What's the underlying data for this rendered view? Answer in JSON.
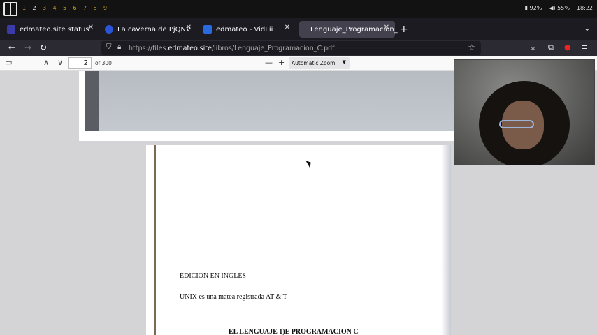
{
  "topbar": {
    "workspaces": [
      "1",
      "2",
      "3",
      "4",
      "5",
      "6",
      "7",
      "8",
      "9"
    ],
    "active_workspace": "2",
    "battery": "92%",
    "volume": "55%",
    "time": "18:22"
  },
  "tabs": [
    {
      "title": "edmateo.site status",
      "favicon": "status-icon",
      "color": "#3a3aa8"
    },
    {
      "title": "La caverna de PjQNV",
      "favicon": "globe-icon",
      "color": "#2a55d8"
    },
    {
      "title": "edmateo - VidLii",
      "favicon": "vidlii-icon",
      "color": "#2a6adf"
    },
    {
      "title": "Lenguaje_Programacion_",
      "favicon": "",
      "color": "#42414d",
      "active": true
    }
  ],
  "navbar": {
    "url_prefix": "https://files.",
    "url_host": "edmateo.site",
    "url_path": "/libros/Lenguaje_Programacion_C.pdf"
  },
  "pdf_toolbar": {
    "page_number": "2",
    "page_count": "of 300",
    "zoom": "Automatic Zoom"
  },
  "document": {
    "line1": "EDICION EN INGLES",
    "line2": "UNIX es una matea registrada AT & T",
    "line3": "EL LENGUAJE 1)E PROGRAMACION C"
  },
  "colors": {
    "tab_active_bg": "#42414d",
    "navbar_bg": "#2b2a33",
    "viewer_bg": "#d4d4d7",
    "workspace_accent": "#c9a227"
  }
}
